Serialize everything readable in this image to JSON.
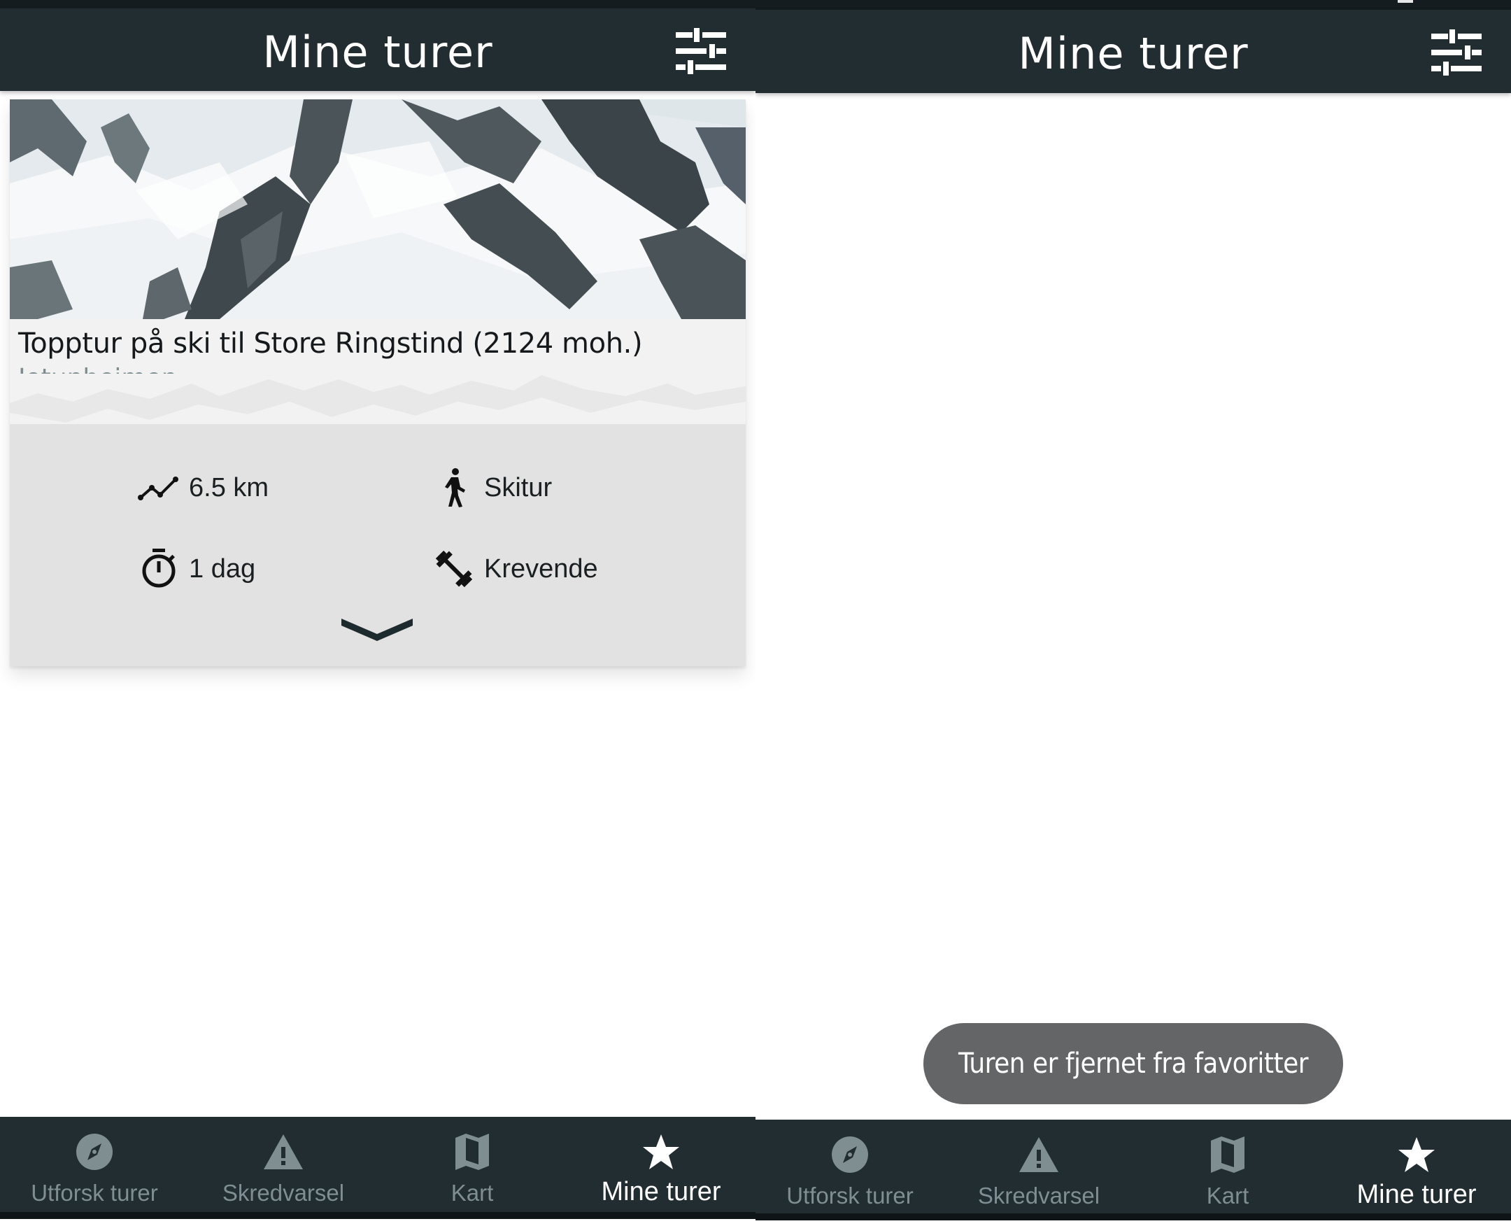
{
  "colors": {
    "appbar": "#222d31",
    "nav_inactive": "#7e8e91",
    "nav_active": "#ffffff",
    "card_bg": "#e2e2e2",
    "subtitle": "#7d8c8f",
    "toast_bg": "#646566"
  },
  "left_screen": {
    "appbar": {
      "title": "Mine turer",
      "filter_icon": "tune-icon"
    },
    "card": {
      "image_icon": "snowy-mountain-photo",
      "title": "Topptur på ski til Store Ringstind (2124 moh.)",
      "region": "Jotunheimen",
      "stats": {
        "distance": {
          "icon": "route-icon",
          "label": "6.5 km"
        },
        "type": {
          "icon": "hiker-icon",
          "label": "Skitur"
        },
        "duration": {
          "icon": "stopwatch-icon",
          "label": "1 dag"
        },
        "difficulty": {
          "icon": "dumbbell-icon",
          "label": "Krevende"
        }
      },
      "expand_icon": "chevron-down-icon"
    }
  },
  "right_screen": {
    "appbar": {
      "title": "Mine turer",
      "filter_icon": "tune-icon"
    },
    "toast": "Turen er fjernet fra favoritter"
  },
  "bottom_nav": {
    "items": [
      {
        "label": "Utforsk turer",
        "icon": "compass-icon",
        "active": false
      },
      {
        "label": "Skredvarsel",
        "icon": "warning-icon",
        "active": false
      },
      {
        "label": "Kart",
        "icon": "map-icon",
        "active": false
      },
      {
        "label": "Mine turer",
        "icon": "star-icon",
        "active": true
      }
    ]
  }
}
